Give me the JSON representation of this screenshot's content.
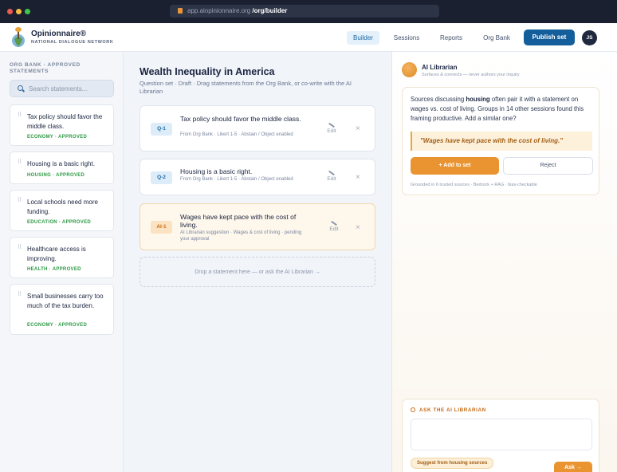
{
  "browser": {
    "domain": "app.aiopinionnaire.org",
    "path": "/org/builder"
  },
  "app": {
    "brand": "Opinionnaire®",
    "brand_sub": "NATIONAL DIALOGUE NETWORK",
    "nav": [
      "Builder",
      "Sessions",
      "Reports",
      "Org Bank"
    ],
    "active_nav": "Builder",
    "publish_label": "Publish set",
    "avatar_initials": "JS"
  },
  "sidebar": {
    "title": "ORG BANK · APPROVED STATEMENTS",
    "search_placeholder": "Search statements...",
    "items": [
      {
        "text": "Tax policy should favor the middle class.",
        "tag": "ECONOMY · APPROVED"
      },
      {
        "text": "Housing is a basic right.",
        "tag": "HOUSING · APPROVED"
      },
      {
        "text": "Local schools need more funding.",
        "tag": "EDUCATION · APPROVED"
      },
      {
        "text": "Healthcare access is improving.",
        "tag": "HEALTH · APPROVED"
      },
      {
        "text": "Small businesses carry too much of the tax burden.",
        "tag": "ECONOMY · APPROVED"
      }
    ]
  },
  "main": {
    "title": "Wealth Inequality in America",
    "subtitle": "Question set · Draft · Drag statements from the Org Bank, or co-write with the AI Librarian",
    "questions": [
      {
        "badge": "Q-1",
        "text": "Tax policy should favor the middle class.",
        "meta": "From Org Bank · Likert 1-5 · Abstain / Object enabled",
        "edit_label": "Edit",
        "close": "×"
      },
      {
        "badge": "Q-2",
        "text": "Housing is a basic right.",
        "meta": "From Org Bank · Likert 1-5 · Abstain / Object enabled",
        "edit_label": "Edit",
        "close": "×"
      },
      {
        "badge": "AI-1",
        "text": "Wages have kept pace with the cost of living.",
        "meta": "AI Librarian suggestion · Wages & cost of living · pending your approval",
        "edit_label": "Edit",
        "close": "×"
      }
    ],
    "dropzone": "Drop a statement here — or ask the AI Librarian →"
  },
  "librarian": {
    "name": "AI Librarian",
    "subtitle": "Surfaces & connects — never authors your inquiry",
    "message_pre": "Sources discussing ",
    "message_bold": "housing",
    "message_post": " often pair it with a statement on wages vs. cost of living. Groups in 14 other sessions found this framing productive. Add a similar one?",
    "quote": "\"Wages have kept pace with the cost of living.\"",
    "add_label": "+ Add to set",
    "reject_label": "Reject",
    "grounded": "Grounded in 6 trusted sources · Bedrock + RAG · bias-checkable",
    "ask_title": "ASK THE AI LIBRARIAN",
    "ask_value": "",
    "chip": "Suggest from housing sources",
    "ask_button": "Ask →"
  }
}
